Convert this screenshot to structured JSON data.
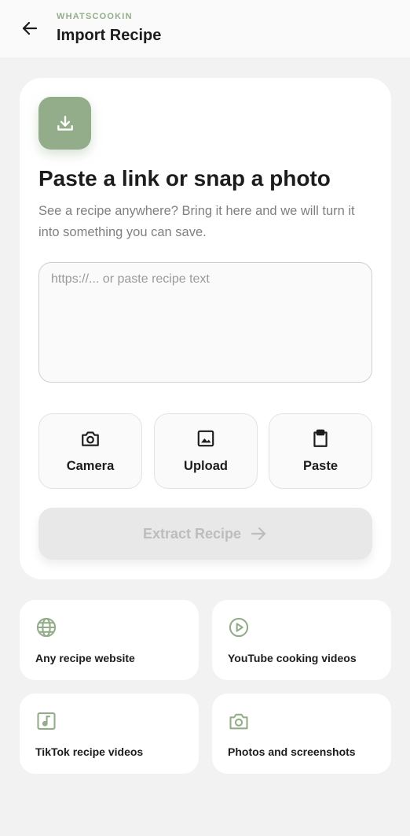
{
  "header": {
    "brand": "WHATSCOOKIN",
    "title": "Import Recipe",
    "back_icon": "arrow-left-icon"
  },
  "import_card": {
    "icon": "download-icon",
    "heading": "Paste a link or snap a photo",
    "description": "See a recipe anywhere? Bring it here and we will turn it into something you can save.",
    "input": {
      "value": "",
      "placeholder": "https://... or paste recipe text"
    },
    "actions": [
      {
        "label": "Camera",
        "icon": "camera-icon"
      },
      {
        "label": "Upload",
        "icon": "image-icon"
      },
      {
        "label": "Paste",
        "icon": "clipboard-icon"
      }
    ],
    "extract_button": {
      "label": "Extract Recipe",
      "icon": "arrow-right-icon",
      "enabled": false
    }
  },
  "sources": [
    {
      "label": "Any recipe website",
      "icon": "globe-icon"
    },
    {
      "label": "YouTube cooking videos",
      "icon": "play-circle-icon"
    },
    {
      "label": "TikTok recipe videos",
      "icon": "music-note-icon"
    },
    {
      "label": "Photos and screenshots",
      "icon": "camera-icon"
    }
  ],
  "colors": {
    "accent": "#93ad8a",
    "background": "#f2f2f2",
    "card": "#ffffff",
    "disabled_button": "#e8e8e8",
    "disabled_text": "#bdbdbd"
  }
}
